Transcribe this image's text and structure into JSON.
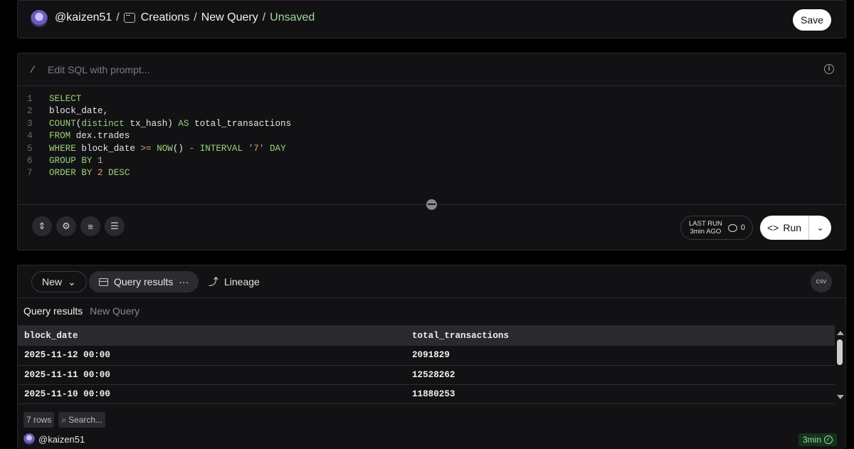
{
  "header": {
    "user": "@kaizen51",
    "sep": "/",
    "folder": "Creations",
    "query_name": "New Query",
    "status": "Unsaved",
    "save_label": "Save"
  },
  "editor": {
    "prompt_placeholder": "Edit SQL with prompt...",
    "line_numbers": [
      "1",
      "2",
      "3",
      "4",
      "5",
      "6",
      "7"
    ],
    "last_run_label_1": "LAST RUN",
    "last_run_label_2": "3min AGO",
    "credits": "0",
    "run_label": "Run"
  },
  "results": {
    "new_label": "New",
    "query_results_tab": "Query results",
    "lineage_tab": "Lineage",
    "csv_label": "CSV",
    "title": "Query results",
    "subtitle": "New Query",
    "columns": [
      "block_date",
      "total_transactions"
    ],
    "rows": [
      [
        "2025-11-12 00:00",
        "2091829"
      ],
      [
        "2025-11-11 00:00",
        "12528262"
      ],
      [
        "2025-11-10 00:00",
        "11880253"
      ]
    ],
    "row_count": "7 rows",
    "search_placeholder": "Search...",
    "author": "@kaizen51",
    "elapsed": "3min"
  },
  "icons": {
    "colors": {
      "accent_green": "#9fd89a",
      "panel": "#121214",
      "border": "#2a2a2e"
    }
  }
}
